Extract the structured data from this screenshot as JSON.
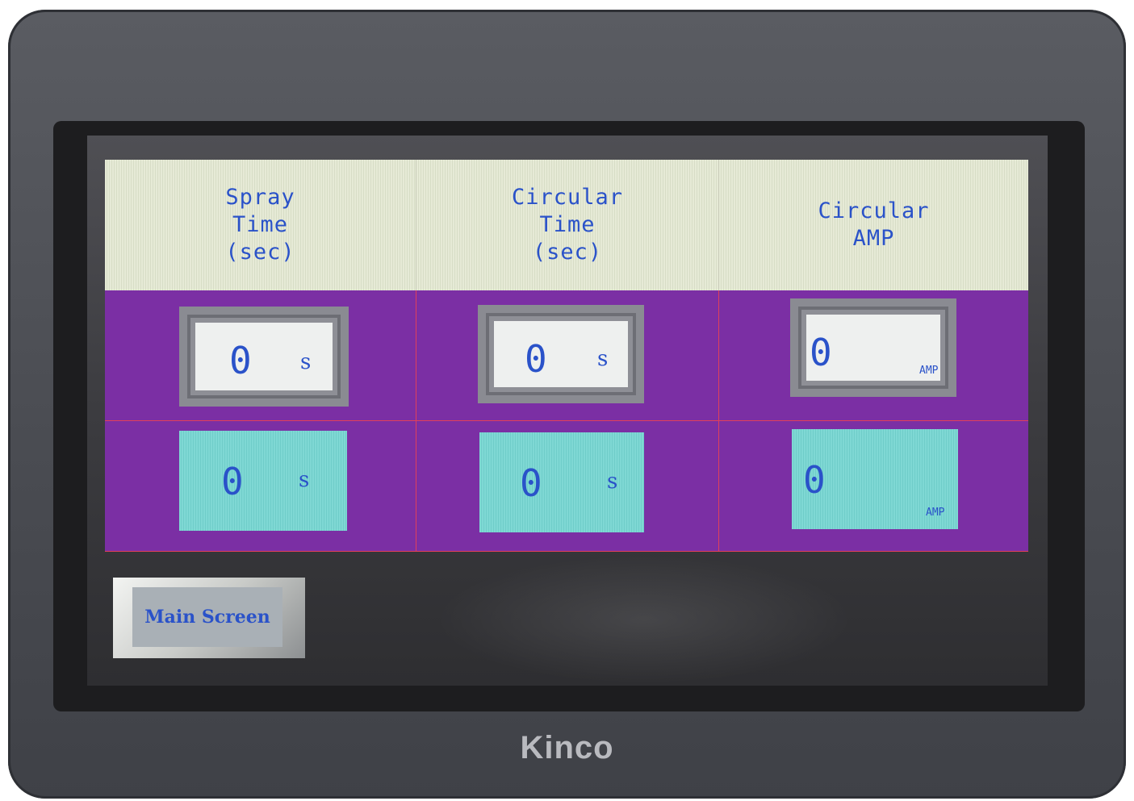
{
  "headers": [
    {
      "label": "Spray\nTime\n(sec)"
    },
    {
      "label": "Circular\nTime\n(sec)"
    },
    {
      "label": "Circular\nAMP"
    }
  ],
  "setpoint_row": [
    {
      "value": "0",
      "unit": "s"
    },
    {
      "value": "0",
      "unit": "s"
    },
    {
      "value": "0",
      "unit": "AMP"
    }
  ],
  "actual_row": [
    {
      "value": "0",
      "unit": "s"
    },
    {
      "value": "0",
      "unit": "s"
    },
    {
      "value": "0",
      "unit": "AMP"
    }
  ],
  "buttons": {
    "main_screen": "Main Screen"
  },
  "brand": "Kinco",
  "colors": {
    "header_bg": "#e6ead6",
    "row_bg": "#7b2fa4",
    "text": "#2a52c9",
    "input_box": "#eef0ef",
    "display_box": "#7fd8d4"
  }
}
